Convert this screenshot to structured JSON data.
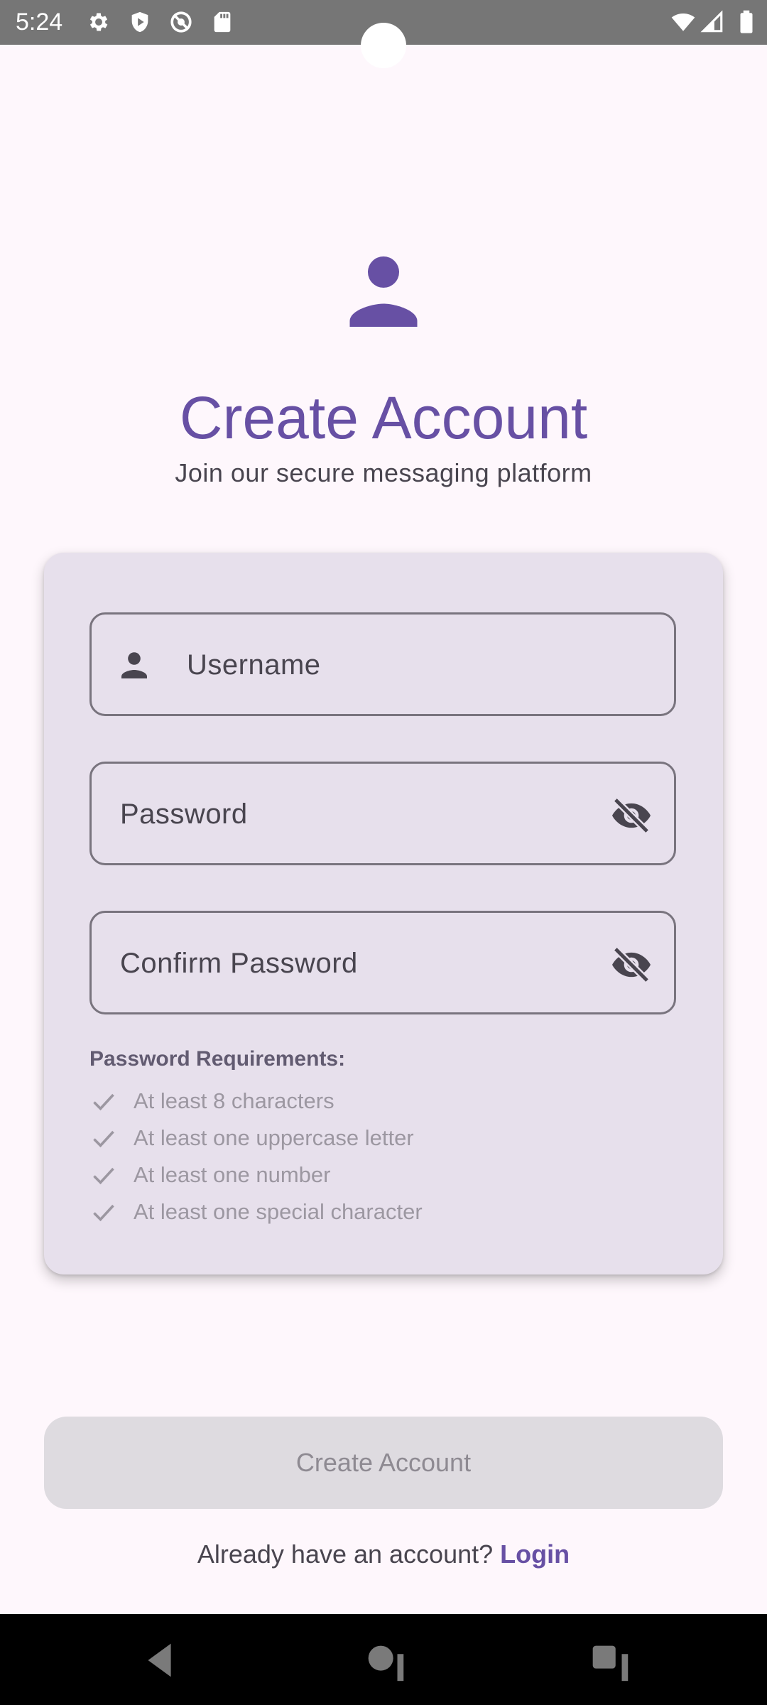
{
  "status_bar": {
    "time": "5:24",
    "left_icons": [
      "gear-icon",
      "shield-play-icon",
      "no-disturb-icon",
      "sd-card-icon"
    ],
    "right_icons": [
      "wifi-icon",
      "signal-icon",
      "battery-icon"
    ]
  },
  "header": {
    "icon": "person-icon",
    "title": "Create Account",
    "subtitle": "Join our secure messaging platform"
  },
  "form": {
    "username_label": "Username",
    "password_label": "Password",
    "confirm_password_label": "Confirm Password",
    "requirements_title": "Password Requirements:",
    "requirements": [
      "At least 8 characters",
      "At least one uppercase letter",
      "At least one number",
      "At least one special character"
    ]
  },
  "actions": {
    "create_account_label": "Create Account",
    "login_prompt": "Already have an account?",
    "login_link": "Login"
  },
  "colors": {
    "primary": "#6750a4",
    "background": "#fef7fc",
    "card": "#e7e0ec",
    "disabled_button": "#dedbe0"
  }
}
